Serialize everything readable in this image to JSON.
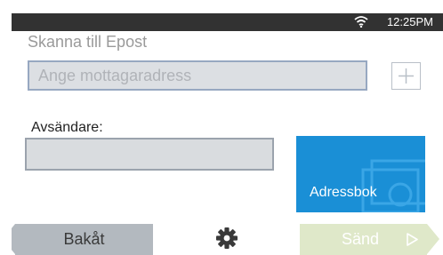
{
  "status": {
    "time": "12:25PM",
    "wifi_icon": "wifi-icon"
  },
  "screen": {
    "title": "Skanna till Epost"
  },
  "recipient": {
    "placeholder": "Ange mottagaradress",
    "value": ""
  },
  "add_button": {
    "icon": "plus-icon"
  },
  "sender": {
    "label": "Avsändare:",
    "value": ""
  },
  "address_book": {
    "label": "Adressbok"
  },
  "footer": {
    "back_label": "Bakåt",
    "settings_icon": "gear-icon",
    "send_label": "Sänd",
    "send_icon": "play-arrow-icon"
  },
  "colors": {
    "status_bar": "#323232",
    "address_book": "#1a8fd6",
    "send_disabled": "#dfe8c9",
    "back": "#b3b9bf"
  }
}
